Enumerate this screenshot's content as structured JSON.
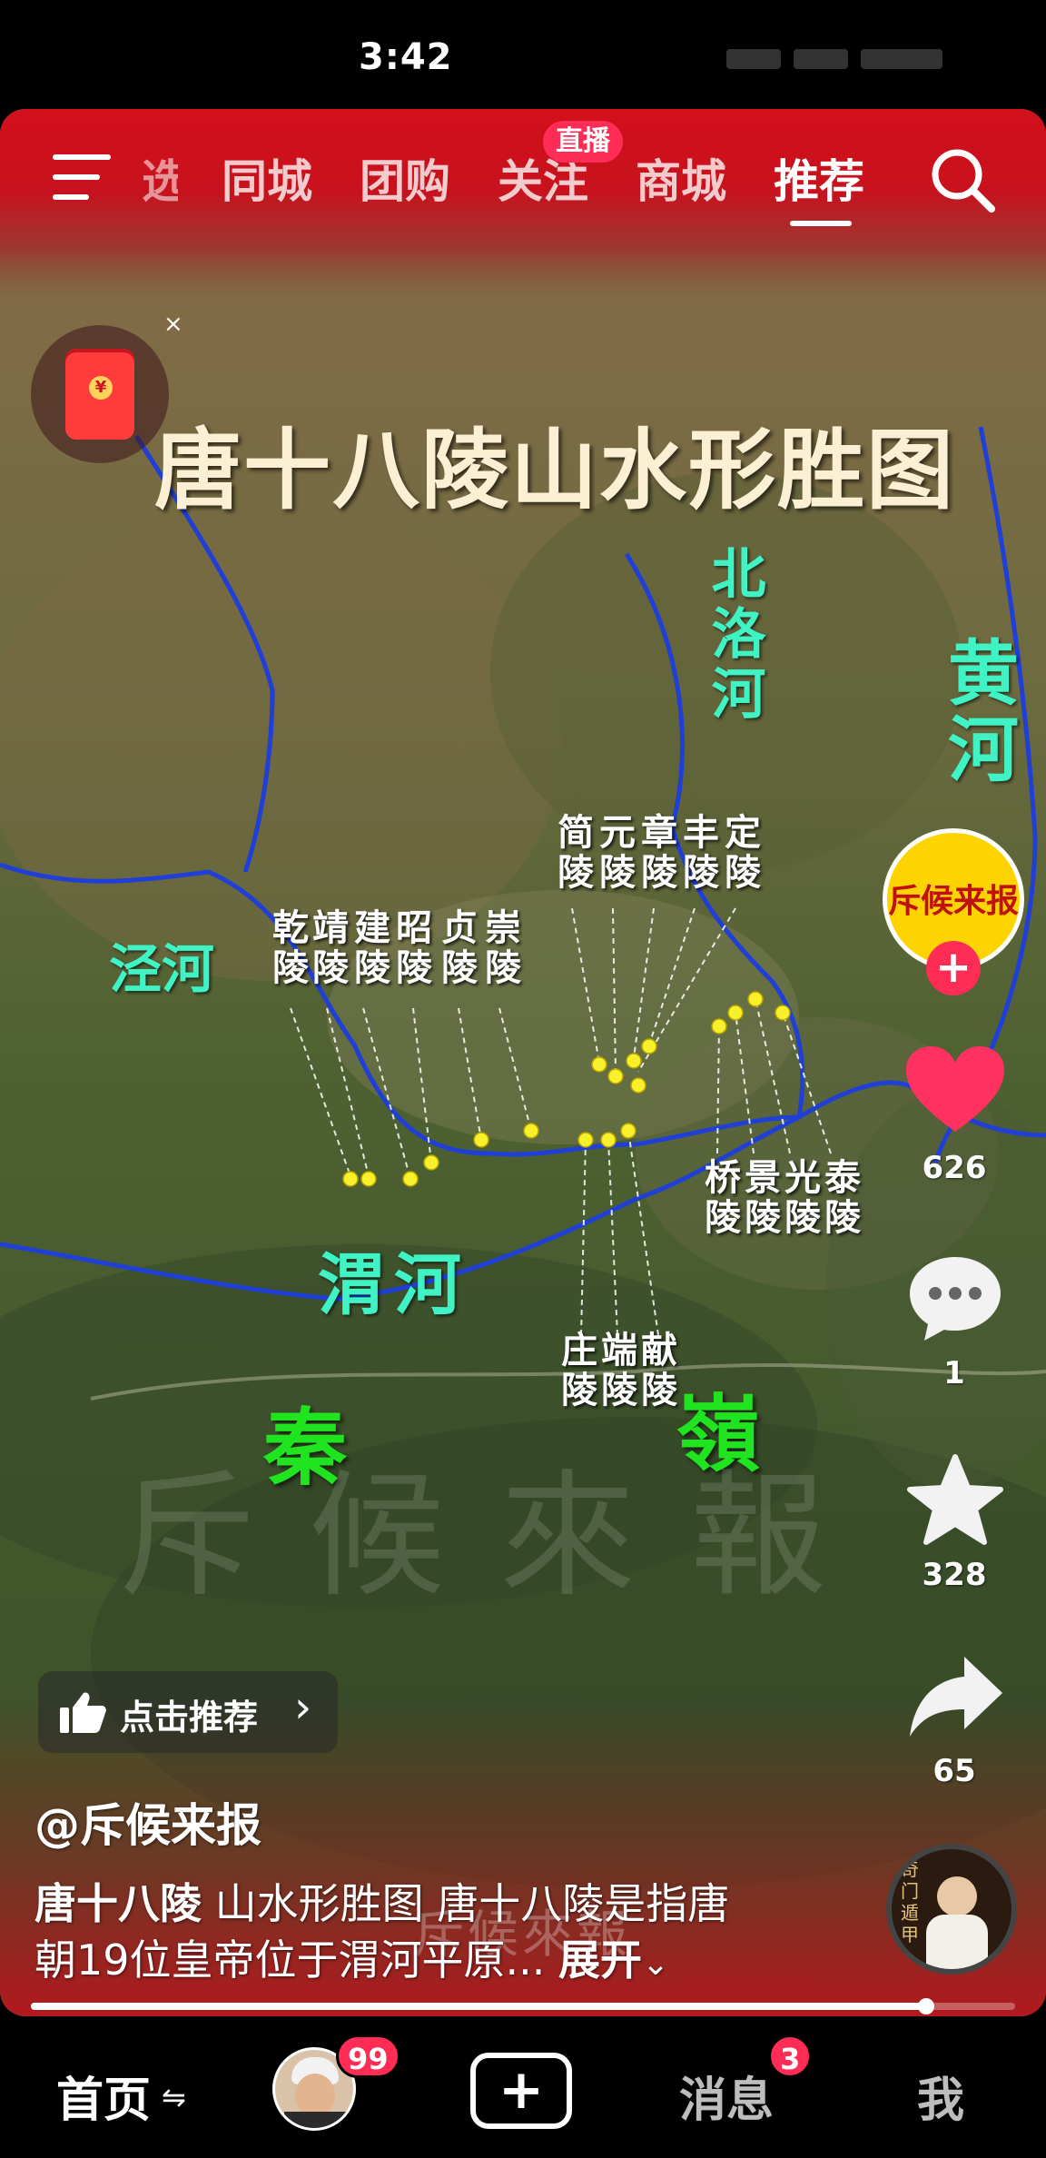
{
  "status_bar": {
    "time": "3:42"
  },
  "top_nav": {
    "tabs": [
      {
        "label": "同城",
        "active": false
      },
      {
        "label": "团购",
        "active": false
      },
      {
        "label": "关注",
        "active": false
      },
      {
        "label": "商城",
        "active": false
      },
      {
        "label": "推荐",
        "active": true
      }
    ],
    "partial_tab": "选",
    "live_badge": "直播",
    "icons": [
      "menu-icon",
      "search-icon"
    ]
  },
  "map": {
    "title": "唐十八陵山水形胜图",
    "rivers": [
      "北洛河",
      "黄河",
      "泾河",
      "渭河"
    ],
    "mountains": [
      "秦",
      "嶺"
    ],
    "tombs_north_west": [
      "乾陵",
      "靖陵",
      "建陵",
      "昭陵",
      "贞陵",
      "崇陵"
    ],
    "tombs_north_center": [
      "简陵",
      "元陵",
      "章陵",
      "丰陵",
      "定陵"
    ],
    "tombs_east": [
      "桥陵",
      "景陵",
      "光陵",
      "泰陵"
    ],
    "tombs_south": [
      "庄陵",
      "端陵",
      "献陵"
    ],
    "watermark": "斥候來報",
    "colors": {
      "river_label": "#3ff3c4",
      "mountain_label": "#1fe41f",
      "river_line": "#1f3fd6",
      "tomb_dot": "#f7f02a"
    }
  },
  "red_packet": {
    "close_glyph": "×",
    "coin_glyph": "¥"
  },
  "right_rail": {
    "author_avatar_text": "斥候来报",
    "follow_glyph": "+",
    "likes": "626",
    "comments": "1",
    "favorites": "328",
    "shares": "65"
  },
  "recommend_pill": {
    "label": "点击推荐",
    "chevron": "›"
  },
  "caption": {
    "author": "@斥候来报",
    "hashtag": "唐十八陵",
    "line1_rest": " 山水形胜图 唐十八陵是指唐",
    "line2": "朝19位皇帝位于渭河平原... ",
    "expand": "展开",
    "expand_chevron": "⌄",
    "overlay_watermark": "斥候來報"
  },
  "progress": {
    "fraction": 0.91
  },
  "music_disc": {
    "text": "奇门遁甲"
  },
  "tabbar": {
    "home": "首页",
    "home_switch": "⇋",
    "friends_badge": "99",
    "create": "+",
    "messages": "消息",
    "messages_badge": "3",
    "me": "我"
  }
}
